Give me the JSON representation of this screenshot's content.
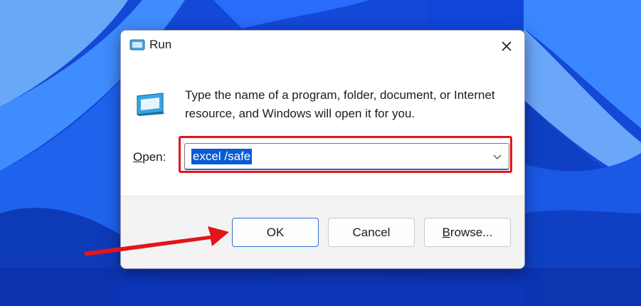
{
  "dialog": {
    "title": "Run",
    "close_icon": "close-icon",
    "title_icon": "run-icon",
    "description": "Type the name of a program, folder, document, or Internet resource, and Windows will open it for you.",
    "open_label": "Open:",
    "open_value": "excel /safe",
    "buttons": {
      "ok": "OK",
      "cancel": "Cancel",
      "browse": "Browse..."
    }
  },
  "colors": {
    "highlight_box": "#e3141b",
    "selection": "#0a5bd3",
    "arrow": "#e3141b",
    "accent": "#2e6fd0"
  },
  "annotations": {
    "arrow_target": "ok-button",
    "highlight_target": "open-combobox"
  }
}
